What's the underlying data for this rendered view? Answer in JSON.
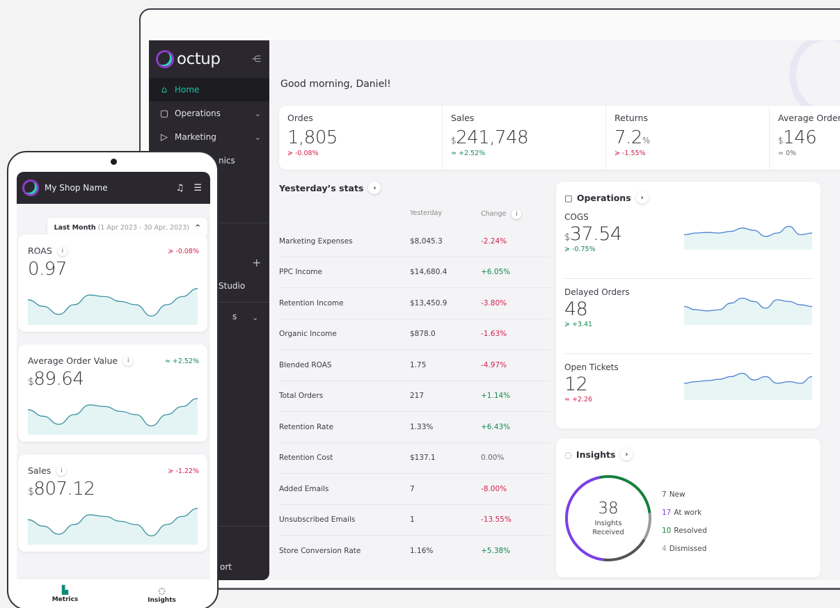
{
  "app": {
    "logo_text": "octup"
  },
  "sidebar": {
    "items": [
      {
        "label": "Home",
        "icon": "home-icon",
        "active": true
      },
      {
        "label": "Operations",
        "icon": "briefcase-icon"
      },
      {
        "label": "Marketing",
        "icon": "megaphone-icon"
      }
    ],
    "partial_labels": [
      "nics",
      "Studio",
      "s",
      "ort"
    ]
  },
  "dashboard": {
    "greeting": "Good morning, Daniel!",
    "kpis": [
      {
        "label": "Ordes",
        "prefix": "",
        "value": "1,805",
        "suffix": "",
        "change": "≽ -0.08%",
        "trend": "neg"
      },
      {
        "label": "Sales",
        "prefix": "$",
        "value": "241,748",
        "suffix": "",
        "change": "≈ +2.52%",
        "trend": "pos"
      },
      {
        "label": "Returns",
        "prefix": "",
        "value": "7.2",
        "suffix": "%",
        "change": "≽ -1.55%",
        "trend": "neg"
      },
      {
        "label": "Average Order",
        "prefix": "$",
        "value": "146",
        "suffix": "",
        "change": "= 0%",
        "trend": "neu"
      }
    ],
    "yesterday": {
      "title": "Yesterday’s stats",
      "col_yesterday": "Yesterday",
      "col_change": "Change",
      "rows": [
        {
          "name": "Marketing Expenses",
          "yesterday": "$8,045.3",
          "change": "-2.24%",
          "trend": "neg"
        },
        {
          "name": "PPC Income",
          "yesterday": "$14,680.4",
          "change": "+6.05%",
          "trend": "pos"
        },
        {
          "name": "Retention Income",
          "yesterday": "$13,450.9",
          "change": "-3.80%",
          "trend": "neg"
        },
        {
          "name": "Organic Income",
          "yesterday": "$878.0",
          "change": "-1.63%",
          "trend": "neg"
        },
        {
          "name": "Blended ROAS",
          "yesterday": "1.75",
          "change": "-4.97%",
          "trend": "neg"
        },
        {
          "name": "Total Orders",
          "yesterday": "217",
          "change": "+1.14%",
          "trend": "pos"
        },
        {
          "name": "Retention Rate",
          "yesterday": "1.33%",
          "change": "+6.43%",
          "trend": "pos"
        },
        {
          "name": "Retention Cost",
          "yesterday": "$137.1",
          "change": "0.00%",
          "trend": "neu"
        },
        {
          "name": "Added Emails",
          "yesterday": "7",
          "change": "-8.00%",
          "trend": "neg"
        },
        {
          "name": "Unsubscribed Emails",
          "yesterday": "1",
          "change": "-13.55%",
          "trend": "neg"
        },
        {
          "name": "Store Conversion Rate",
          "yesterday": "1.16%",
          "change": "+5.38%",
          "trend": "pos"
        }
      ]
    },
    "operations": {
      "title": "Operations",
      "metrics": [
        {
          "label": "COGS",
          "prefix": "$",
          "value": "37.54",
          "change": "≽ -0.75%",
          "trend": "pos",
          "spark": [
            0.55,
            0.5,
            0.48,
            0.5,
            0.45,
            0.35,
            0.42,
            0.6,
            0.5,
            0.3,
            0.55,
            0.5
          ]
        },
        {
          "label": "Delayed Orders",
          "prefix": "",
          "value": "48",
          "change": "≽ +3.41",
          "trend": "pos",
          "spark": [
            0.45,
            0.55,
            0.58,
            0.55,
            0.35,
            0.2,
            0.3,
            0.5,
            0.25,
            0.3,
            0.4,
            0.45
          ]
        },
        {
          "label": "Open Tickets",
          "prefix": "",
          "value": "12",
          "change": "≈ +2.26",
          "trend": "neg",
          "spark": [
            0.5,
            0.45,
            0.42,
            0.38,
            0.3,
            0.2,
            0.4,
            0.3,
            0.5,
            0.45,
            0.5,
            0.3
          ]
        }
      ]
    },
    "insights": {
      "title": "Insights",
      "total": "38",
      "total_label_line1": "Insights",
      "total_label_line2": "Received",
      "legend": [
        {
          "count": "7",
          "label": "New",
          "color": "#555555"
        },
        {
          "count": "17",
          "label": "At work",
          "color": "#7b3fe4"
        },
        {
          "count": "10",
          "label": "Resolved",
          "color": "#15803d"
        },
        {
          "count": "4",
          "label": "Dismissed",
          "color": "#9a9aa2"
        }
      ]
    }
  },
  "phone": {
    "shop_name": "My Shop Name",
    "date_range_label": "Last Month",
    "date_range_value": "(1 Apr 2023 - 30 Apr, 2023)",
    "cards": [
      {
        "label": "ROAS",
        "prefix": "",
        "value": "0.97",
        "change": "≽ -0.08%",
        "trend": "neg"
      },
      {
        "label": "Average Order Value",
        "prefix": "$",
        "value": "89.64",
        "change": "≈ +2.52%",
        "trend": "pos"
      },
      {
        "label": "Sales",
        "prefix": "$",
        "value": "807.12",
        "change": "≽ -1.22%",
        "trend": "neg"
      }
    ],
    "tabs": [
      {
        "label": "Metrics",
        "icon": "bar-chart-icon",
        "active": true
      },
      {
        "label": "Insights",
        "icon": "lightbulb-icon"
      }
    ]
  },
  "colors": {
    "accent": "#10897a",
    "negative": "#d3204c",
    "positive": "#10894d",
    "sidebar": "#2a282e"
  }
}
